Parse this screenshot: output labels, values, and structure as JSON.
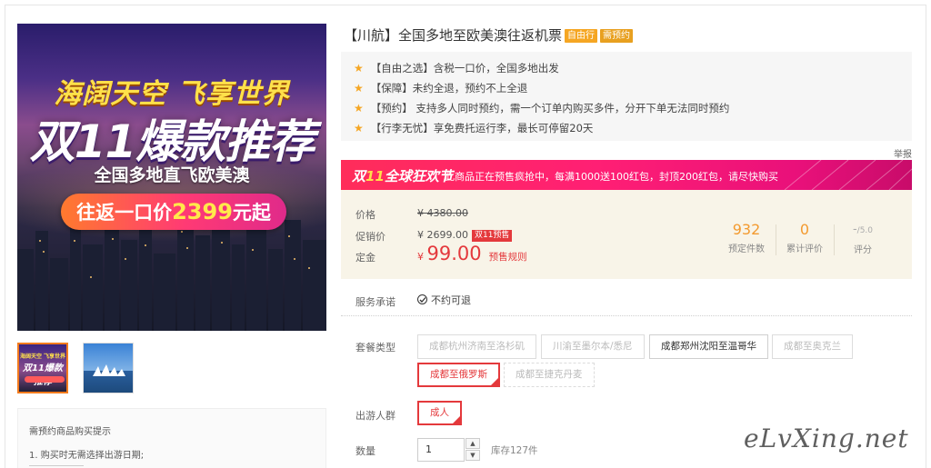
{
  "gallery": {
    "main_banner": {
      "line1": "海阔天空 飞享世界",
      "line2": "双11爆款推荐",
      "line3": "全国多地直飞欧美澳",
      "pill_prefix": "往返一口价",
      "pill_price": "2399",
      "pill_suffix": "元起"
    },
    "thumb1": {
      "line1": "海阔天空 飞享世界",
      "line2": "双11爆款推荐"
    },
    "notice": {
      "title": "需预约商品购买提示",
      "item1": "1. 购买时无需选择出游日期;"
    }
  },
  "product": {
    "title": "【川航】全国多地至欧美澳往返机票",
    "tag_free": "自由行",
    "tag_reserve": "需预约",
    "features": [
      "【自由之选】含税一口价，全国多地出发",
      "【保障】未约全退，预约不上全退",
      "【预约】 支持多人同时预约，需一个订单内购买多件，分开下单无法同时预约",
      "【行李无忧】享免费托运行李，最长可停留20天"
    ],
    "report_link": "举报"
  },
  "festival": {
    "logo_prefix": "双",
    "logo_mark": "11",
    "logo_text": "全球狂欢节",
    "text": "此商品正在预售疯抢中，每满1000送100红包，封顶200红包，请尽快购买"
  },
  "price": {
    "label_price": "价格",
    "original": "¥ 4380.00",
    "label_promo": "促销价",
    "promo": "¥ 2699.00",
    "promo_badge": "双11预售",
    "label_deposit": "定金",
    "deposit_currency": "¥",
    "deposit": "99.00",
    "deposit_rule": "预售规则",
    "stats": [
      {
        "num": "932",
        "caption": "预定件数"
      },
      {
        "num": "0",
        "caption": "累计评价"
      },
      {
        "num": "-",
        "den": "/5.0",
        "caption": "评分"
      }
    ]
  },
  "service": {
    "label": "服务承诺",
    "value": "不约可退"
  },
  "package": {
    "label": "套餐类型",
    "options": [
      "成都杭州济南至洛杉矶",
      "川渝至墨尔本/悉尼",
      "成都郑州沈阳至温哥华",
      "成都至奥克兰",
      "成都至俄罗斯",
      "成都至捷克丹麦"
    ]
  },
  "travelers": {
    "label": "出游人群",
    "options": [
      "成人"
    ]
  },
  "quantity": {
    "label": "数量",
    "value": "1",
    "up": "▲",
    "down": "▼",
    "stock": "库存127件"
  },
  "watermark": "eLvXing.net",
  "colors": {
    "accent_red": "#e4393c",
    "festival_pink": "#ff1f74",
    "star_orange": "#f5a623"
  }
}
